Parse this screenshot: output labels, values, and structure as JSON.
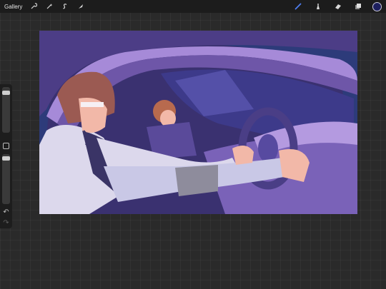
{
  "toolbar": {
    "gallery_label": "Gallery",
    "left_icons": [
      "wrench-icon",
      "magic-wand-icon",
      "selection-s-icon",
      "transform-arrow-icon"
    ],
    "right_icons": [
      "brush-icon",
      "smudge-icon",
      "eraser-icon",
      "layers-icon"
    ],
    "current_color": "#1d1f5e",
    "active_tool_color": "#4f7df0"
  },
  "sidebar": {
    "brush_size_level": 0.92,
    "opacity_level": 0.95,
    "icons": [
      "modify-square-icon",
      "undo-icon",
      "redo-icon"
    ]
  },
  "artwork": {
    "palette": {
      "sky": "#2d3b7a",
      "car_frame": "#6e56a8",
      "car_frame_light": "#a68ad8",
      "interior": "#3e3472",
      "hair": "#9b5a52",
      "skin": "#f2b8a8",
      "shirt": "#dcd8ec"
    }
  }
}
